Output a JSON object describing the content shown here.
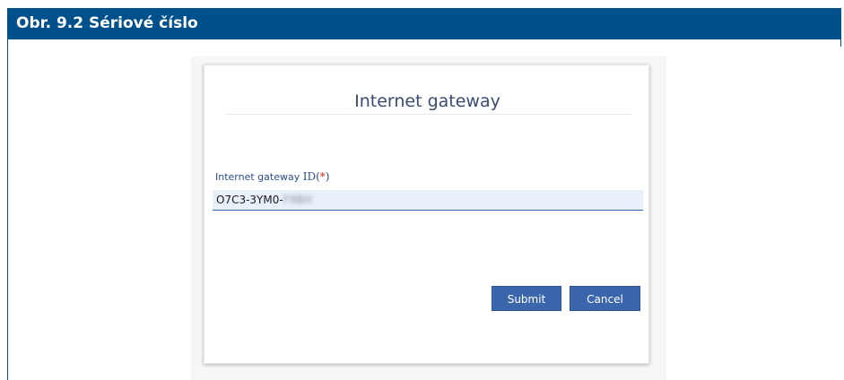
{
  "figure": {
    "caption": "Obr. 9.2 Sériové číslo"
  },
  "dialog": {
    "title": "Internet gateway",
    "field": {
      "label_text": "Internet gateway",
      "label_id": "ID(",
      "label_required": "*",
      "label_close": ")",
      "value_visible": "O7C3-3YM0-",
      "value_obscured": "F9BH"
    },
    "buttons": {
      "submit": "Submit",
      "cancel": "Cancel"
    }
  },
  "colors": {
    "header_bg": "#00508c",
    "button_bg": "#3c66ac",
    "title_text": "#3a4b73",
    "required_marker": "#e0241c"
  }
}
